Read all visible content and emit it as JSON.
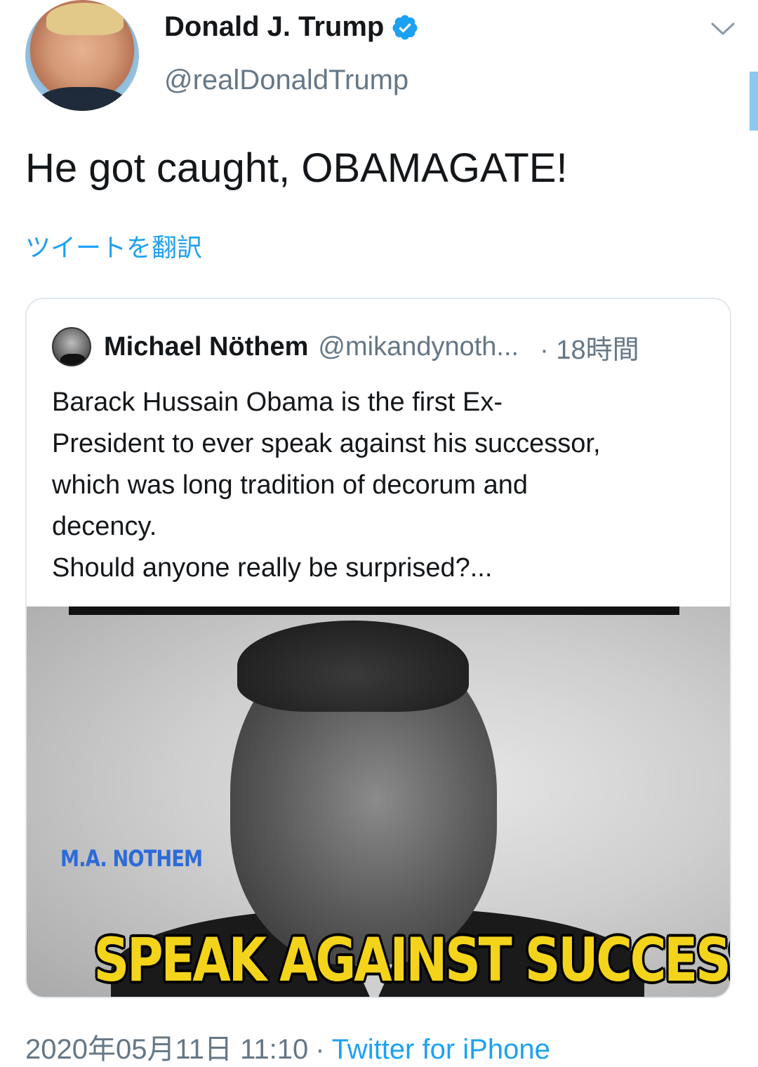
{
  "author": {
    "name": "Donald J. Trump",
    "handle": "@realDonaldTrump",
    "verified_icon": "verified-badge-icon"
  },
  "tweet": {
    "text": "He got caught, OBAMAGATE!",
    "translate_link": "ツイートを翻訳"
  },
  "quoted_tweet": {
    "name": "Michael Nöthem",
    "handle": "@mikandynoth...",
    "time": "· 18時間",
    "text": "Barack Hussain Obama is the first Ex-\nPresident to ever speak against his successor,\nwhich was long tradition of decorum and\ndecency.\nShould anyone really be surprised?...",
    "image": {
      "watermark": "M.A. NOTHEM",
      "caption": "SPEAK AGAINST SUCCESSOR"
    }
  },
  "footer": {
    "date": "2020年05月11日 11:10",
    "separator": "·",
    "source": "Twitter for iPhone"
  },
  "colors": {
    "accent": "#1da1f2",
    "secondary_text": "#657786",
    "caption_yellow": "#f4d41b"
  }
}
